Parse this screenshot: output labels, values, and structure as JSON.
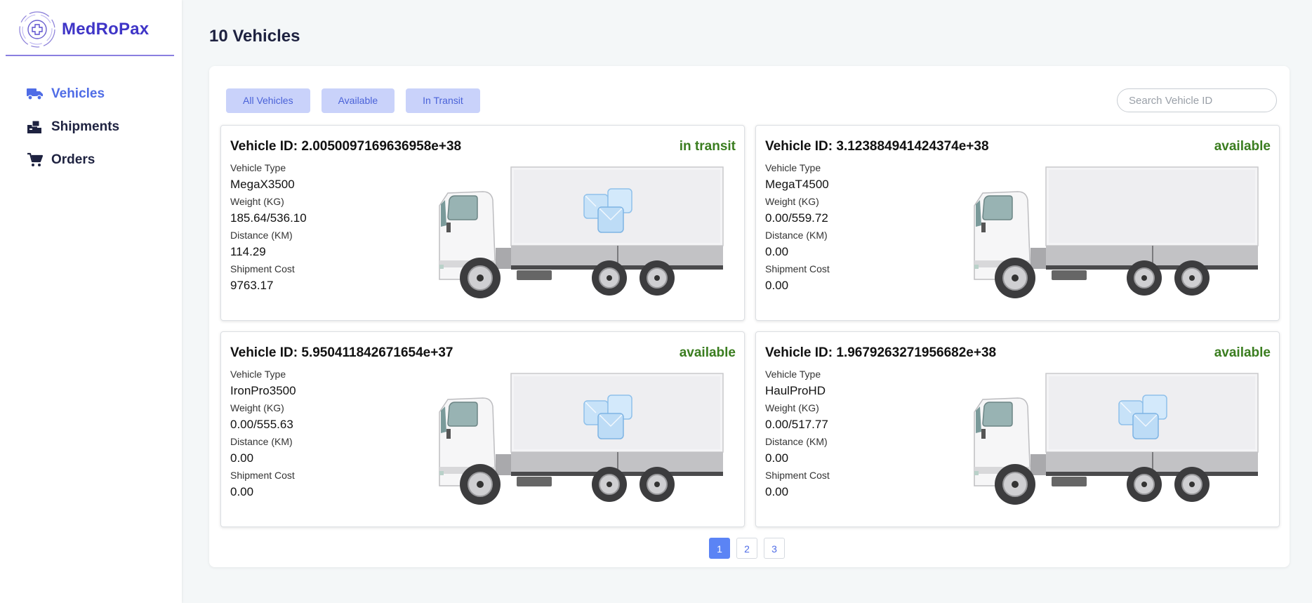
{
  "brand": {
    "name": "MedRoPax"
  },
  "sidebar": {
    "items": [
      {
        "label": "Vehicles",
        "icon": "truck-icon",
        "active": true
      },
      {
        "label": "Shipments",
        "icon": "shipments-icon",
        "active": false
      },
      {
        "label": "Orders",
        "icon": "cart-icon",
        "active": false
      }
    ]
  },
  "main": {
    "title": "10 Vehicles",
    "filters": [
      "All Vehicles",
      "Available",
      "In Transit"
    ],
    "search": {
      "placeholder": "Search Vehicle ID",
      "value": ""
    },
    "labels": {
      "type": "Vehicle Type",
      "weight": "Weight (KG)",
      "distance": "Distance (KM)",
      "cost": "Shipment Cost"
    },
    "vehicles": [
      {
        "id": "Vehicle ID: 2.0050097169636958e+38",
        "status": "in transit",
        "type": "MegaX3500",
        "weight": "185.64/536.10",
        "distance": "114.29",
        "cost": "9763.17",
        "cargo": true
      },
      {
        "id": "Vehicle ID: 3.123884941424374e+38",
        "status": "available",
        "type": "MegaT4500",
        "weight": "0.00/559.72",
        "distance": "0.00",
        "cost": "0.00",
        "cargo": false
      },
      {
        "id": "Vehicle ID: 5.950411842671654e+37",
        "status": "available",
        "type": "IronPro3500",
        "weight": "0.00/555.63",
        "distance": "0.00",
        "cost": "0.00",
        "cargo": true
      },
      {
        "id": "Vehicle ID: 1.9679263271956682e+38",
        "status": "available",
        "type": "HaulProHD",
        "weight": "0.00/517.77",
        "distance": "0.00",
        "cost": "0.00",
        "cargo": true
      }
    ],
    "pagination": {
      "pages": [
        "1",
        "2",
        "3"
      ],
      "current": "1"
    }
  },
  "colors": {
    "brand": "#3f35c7",
    "accent": "#4f6ce6",
    "filter_bg": "#c9d2fa",
    "status": "#3a7d1f",
    "page_active": "#5b84f5"
  }
}
